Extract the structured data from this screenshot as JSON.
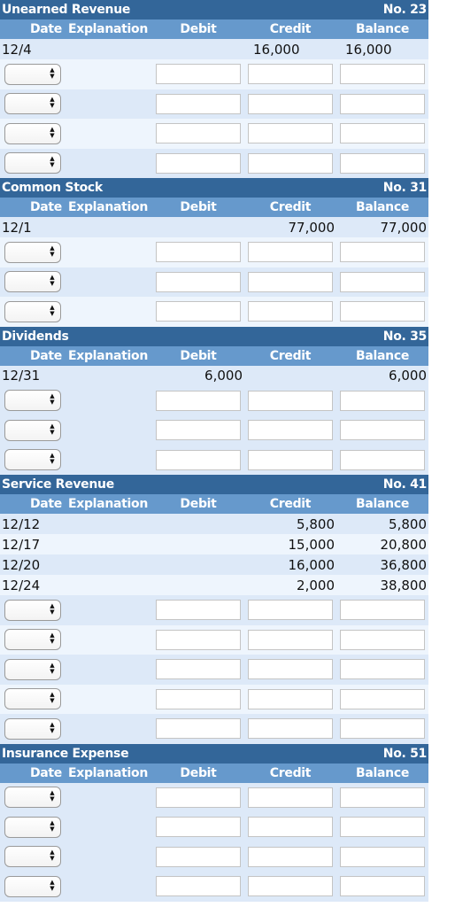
{
  "columns": {
    "date": "Date",
    "explanation": "Explanation",
    "debit": "Debit",
    "credit": "Credit",
    "balance": "Balance"
  },
  "colors": {
    "title_bar": "#336699",
    "column_header": "#6699cc",
    "row_dark": "#dde9f8",
    "row_light": "#eef5fd"
  },
  "accounts": [
    {
      "name": "Unearned Revenue",
      "number": "No. 23",
      "entries": [
        {
          "date": "12/4",
          "explanation": "",
          "debit": "",
          "credit": "16,000",
          "balance": "16,000"
        }
      ],
      "input_rows": 4
    },
    {
      "name": "Common Stock",
      "number": "No. 31",
      "entries": [
        {
          "date": "12/1",
          "explanation": "",
          "debit": "",
          "credit": "77,000",
          "balance": "77,000"
        }
      ],
      "input_rows": 3
    },
    {
      "name": "Dividends",
      "number": "No. 35",
      "entries": [
        {
          "date": "12/31",
          "explanation": "",
          "debit": "6,000",
          "credit": "",
          "balance": "6,000"
        }
      ],
      "input_rows": 3
    },
    {
      "name": "Service Revenue",
      "number": "No. 41",
      "entries": [
        {
          "date": "12/12",
          "explanation": "",
          "debit": "",
          "credit": "5,800",
          "balance": "5,800"
        },
        {
          "date": "12/17",
          "explanation": "",
          "debit": "",
          "credit": "15,000",
          "balance": "20,800"
        },
        {
          "date": "12/20",
          "explanation": "",
          "debit": "",
          "credit": "16,000",
          "balance": "36,800"
        },
        {
          "date": "12/24",
          "explanation": "",
          "debit": "",
          "credit": "2,000",
          "balance": "38,800"
        }
      ],
      "input_rows": 5
    },
    {
      "name": "Insurance Expense",
      "number": "No. 51",
      "entries": [],
      "input_rows": 4
    }
  ],
  "select_icon": "up-down-arrows-icon"
}
